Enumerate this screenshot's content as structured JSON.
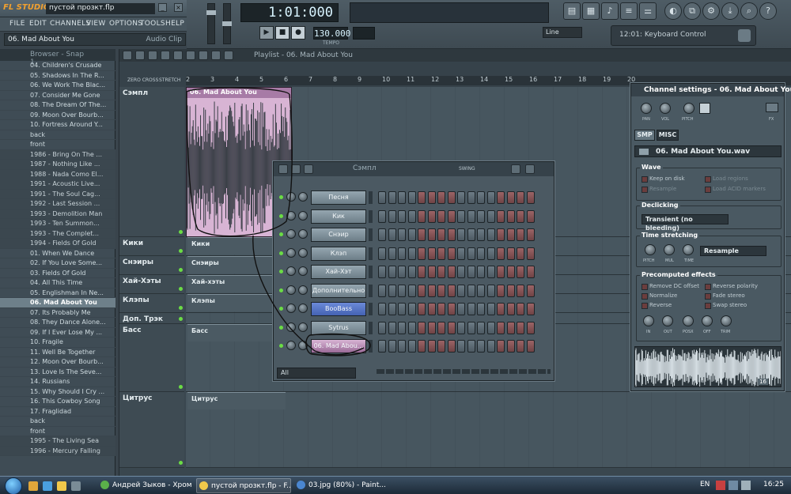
{
  "app": {
    "logo": "FL STUDIO",
    "document_title": "пустой прозкт.flp"
  },
  "menu": [
    "FILE",
    "EDIT",
    "CHANNELS",
    "VIEW",
    "OPTIONS",
    "TOOLS",
    "HELP"
  ],
  "hint_bar": {
    "left": "06. Mad About You",
    "right": "Audio Clip"
  },
  "transport": {
    "time": "1:01:000",
    "tempo": "130.000",
    "tempo_label": "TEMPO",
    "snap": "Line",
    "hint_panel": "12:01: Keyboard Control"
  },
  "browser": {
    "header": "Browser - Snap 1",
    "items": [
      {
        "label": "04. Children's Crusade",
        "type": "file"
      },
      {
        "label": "05. Shadows In The R...",
        "type": "file"
      },
      {
        "label": "06. We Work The Blac...",
        "type": "file"
      },
      {
        "label": "07. Consider Me Gone",
        "type": "file"
      },
      {
        "label": "08. The Dream Of The...",
        "type": "file"
      },
      {
        "label": "09. Moon Over Bourb...",
        "type": "file"
      },
      {
        "label": "10. Fortress Around Y...",
        "type": "file"
      },
      {
        "label": "back",
        "type": "nav"
      },
      {
        "label": "front",
        "type": "nav"
      },
      {
        "label": "1986 - Bring On The ...",
        "type": "folder"
      },
      {
        "label": "1987 - Nothing Like ...",
        "type": "folder"
      },
      {
        "label": "1988 - Nada Como El...",
        "type": "folder"
      },
      {
        "label": "1991 - Acoustic Live...",
        "type": "folder"
      },
      {
        "label": "1991 - The Soul Cag...",
        "type": "folder"
      },
      {
        "label": "1992 - Last Session ...",
        "type": "folder"
      },
      {
        "label": "1993 - Demolition Man",
        "type": "folder"
      },
      {
        "label": "1993 - Ten Summon...",
        "type": "folder"
      },
      {
        "label": "1993 - The Complet...",
        "type": "folder"
      },
      {
        "label": "1994 - Fields Of Gold",
        "type": "folder"
      },
      {
        "label": "01. When We Dance",
        "type": "file"
      },
      {
        "label": "02. If You Love Some...",
        "type": "file"
      },
      {
        "label": "03. Fields Of Gold",
        "type": "file"
      },
      {
        "label": "04. All This Time",
        "type": "file"
      },
      {
        "label": "05. Englishman In Ne...",
        "type": "file"
      },
      {
        "label": "06. Mad About You",
        "type": "selected"
      },
      {
        "label": "07. Its Probably Me",
        "type": "file"
      },
      {
        "label": "08. They Dance Alone...",
        "type": "file"
      },
      {
        "label": "09. If I Ever Lose My ...",
        "type": "file"
      },
      {
        "label": "10. Fragile",
        "type": "file"
      },
      {
        "label": "11. Well Be Together",
        "type": "file"
      },
      {
        "label": "12. Moon Over Bourb...",
        "type": "file"
      },
      {
        "label": "13. Love Is The Seve...",
        "type": "file"
      },
      {
        "label": "14. Russians",
        "type": "file"
      },
      {
        "label": "15. Why Should I Cry ...",
        "type": "file"
      },
      {
        "label": "16. This Cowboy Song",
        "type": "file"
      },
      {
        "label": "17. Fraglidad",
        "type": "file"
      },
      {
        "label": "back",
        "type": "nav"
      },
      {
        "label": "front",
        "type": "nav"
      },
      {
        "label": "1995 - The Living Sea",
        "type": "folder"
      },
      {
        "label": "1996 - Mercury Falling",
        "type": "folder"
      }
    ]
  },
  "playlist": {
    "title": "Playlist - 06. Mad About You",
    "zero_label": "ZERO CROSS",
    "stretch_label": "STRETCH",
    "ruler": [
      "2",
      "3",
      "4",
      "5",
      "6",
      "7",
      "8",
      "9",
      "10",
      "11",
      "12",
      "13",
      "14",
      "15",
      "16",
      "17",
      "18",
      "19",
      "20"
    ],
    "audio_clip": "06. Mad About You",
    "tracks": [
      {
        "name": "Сэмпл",
        "clip": ""
      },
      {
        "name": "Кики",
        "clip": "Кики"
      },
      {
        "name": "Снэиры",
        "clip": "Снэиры"
      },
      {
        "name": "Хай-Хэты",
        "clip": "Хай-хэты"
      },
      {
        "name": "Клэпы",
        "clip": "Клэпы"
      },
      {
        "name": "Доп. Трэк",
        "clip": ""
      },
      {
        "name": "Басс",
        "clip": "Басс"
      },
      {
        "name": "Цитрус",
        "clip": "Цитрус"
      }
    ]
  },
  "step_sequencer": {
    "title": "Сэмпл",
    "swing_label": "SWING",
    "channels": [
      {
        "name": "Песня",
        "color": "grey"
      },
      {
        "name": "Кик",
        "color": "grey"
      },
      {
        "name": "Снэир",
        "color": "grey"
      },
      {
        "name": "Клэп",
        "color": "grey"
      },
      {
        "name": "Хай-Хэт",
        "color": "grey"
      },
      {
        "name": "Дополнительно",
        "color": "grey"
      },
      {
        "name": "BooBass",
        "color": "blue"
      },
      {
        "name": "Sytrus",
        "color": "grey"
      },
      {
        "name": "06. Mad Abou...",
        "color": "pink"
      }
    ],
    "filter": "All"
  },
  "channel_settings": {
    "title": "Channel settings - 06. Mad About You",
    "knobs": [
      "PAN",
      "VOL",
      "PITCH",
      "FX"
    ],
    "tabs": [
      "SMP",
      "MISC"
    ],
    "sample": "06. Mad About You.wav",
    "wave": {
      "title": "Wave",
      "options": [
        "Keep on disk",
        "Resample",
        "Load regions",
        "Load ACID markers"
      ]
    },
    "declicking": {
      "title": "Declicking",
      "value": "Transient (no bleeding)"
    },
    "time_stretching": {
      "title": "Time stretching",
      "knobs": [
        "PITCH",
        "MUL",
        "TIME"
      ],
      "value": "Resample"
    },
    "precomputed": {
      "title": "Precomputed effects",
      "options": [
        "Remove DC offset",
        "Normalize",
        "Reverse",
        "Reverse polarity",
        "Fade stereo",
        "Swap stereo"
      ],
      "knobs": [
        "IN",
        "OUT",
        "POSX",
        "OFF",
        "TRIM"
      ]
    },
    "wave_badge": "16"
  },
  "taskbar": {
    "tasks": [
      {
        "label": "Андрей Зыков - Хром",
        "active": false
      },
      {
        "label": "пустой прозкт.flp - F...",
        "active": true
      },
      {
        "label": "03.jpg (80%) - Paint...",
        "active": false
      }
    ],
    "lang": "EN",
    "clock": "16:25"
  }
}
